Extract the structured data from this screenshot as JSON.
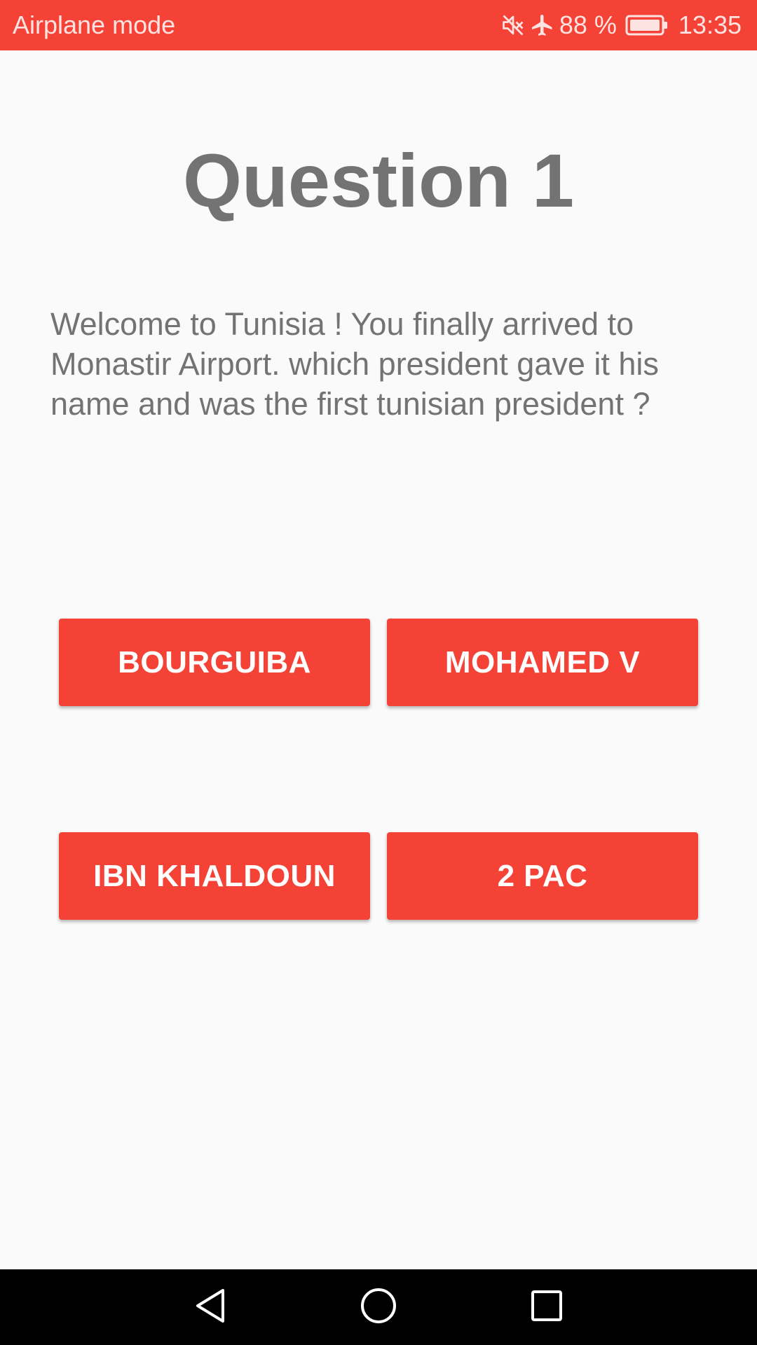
{
  "status_bar": {
    "left_text": "Airplane mode",
    "battery_percent": "88 %",
    "time": "13:35",
    "icons": [
      "mute-icon",
      "airplane-icon",
      "battery-icon"
    ],
    "background_color": "#f44336"
  },
  "main": {
    "title": "Question 1",
    "question": "Welcome to Tunisia ! You finally arrived to Monastir Airport. which president gave it his name and was the first tunisian president ?",
    "answers": [
      {
        "label": "BOURGUIBA"
      },
      {
        "label": "MOHAMED V"
      },
      {
        "label": "IBN KHALDOUN"
      },
      {
        "label": "2 PAC"
      }
    ],
    "accent_color": "#f44336"
  },
  "nav_bar": {
    "icons": [
      "back-icon",
      "home-icon",
      "recents-icon"
    ]
  }
}
